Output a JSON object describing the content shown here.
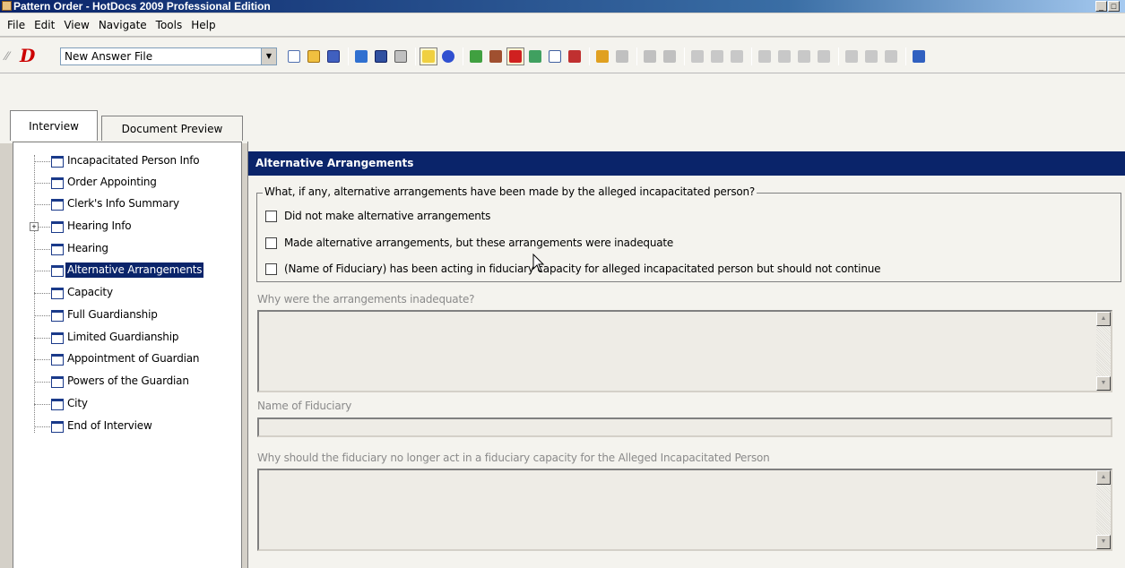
{
  "window": {
    "title": "Pattern Order - HotDocs 2009 Professional Edition",
    "buttons": [
      "_",
      "□"
    ]
  },
  "menu": [
    "File",
    "Edit",
    "View",
    "Navigate",
    "Tools",
    "Help"
  ],
  "toolbar": {
    "answer_file": "New Answer File",
    "icons": [
      "new-document-icon",
      "open-answer-icon",
      "edit-answer-icon",
      "next-icon",
      "save-icon",
      "print-icon",
      "interview-icon",
      "help-icon",
      "spell-check-icon",
      "link-icon",
      "stop-icon",
      "grid-icon",
      "checklist-icon",
      "flag-icon",
      "highlight-icon",
      "erase-icon",
      "undo-icon",
      "redo-icon",
      "cut-icon",
      "copy-icon",
      "paste-icon",
      "indent-icon",
      "outdent-icon",
      "move-up-icon",
      "move-down-icon",
      "sort-icon",
      "edit-icon",
      "underline-icon",
      "exit-icon"
    ]
  },
  "tabs": {
    "interview": "Interview",
    "preview": "Document Preview"
  },
  "tree": {
    "items": [
      {
        "label": "Incapacitated Person Info"
      },
      {
        "label": "Order Appointing"
      },
      {
        "label": "Clerk's Info Summary"
      },
      {
        "label": "Hearing Info",
        "expander": "+"
      },
      {
        "label": "Hearing"
      },
      {
        "label": "Alternative Arrangements",
        "selected": true
      },
      {
        "label": "Capacity"
      },
      {
        "label": "Full Guardianship"
      },
      {
        "label": "Limited Guardianship"
      },
      {
        "label": "Appointment of Guardian"
      },
      {
        "label": "Powers of the Guardian"
      },
      {
        "label": "City"
      },
      {
        "label": "End of Interview"
      }
    ]
  },
  "dialog": {
    "header": "Alternative Arrangements",
    "group_question": "What, if any, alternative arrangements have been made by the alleged incapacitated person?",
    "options": [
      "Did not make alternative arrangements",
      "Made alternative arrangements, but these arrangements were inadequate",
      "(Name of Fiduciary) has been acting in fiduciary capacity for alleged incapacitated person but should not continue"
    ],
    "q_inadequate": "Why were the arrangements inadequate?",
    "q_fiduciary_name": "Name of Fiduciary",
    "q_no_longer_act": "Why should the fiduciary no longer act in a fiduciary capacity for the Alleged Incapacitated Person"
  }
}
